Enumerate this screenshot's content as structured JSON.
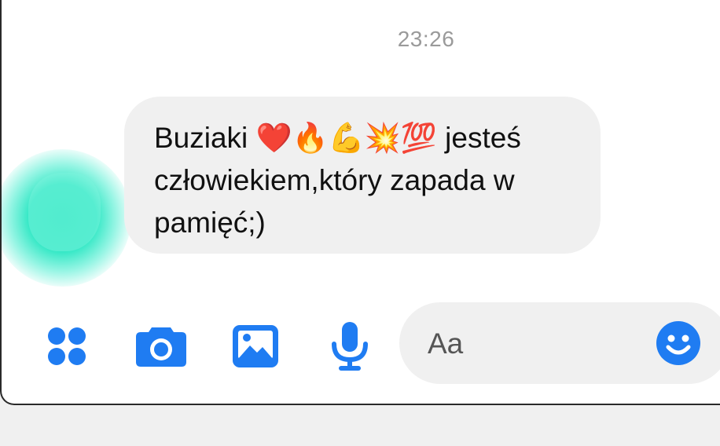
{
  "chat": {
    "timestamp": "23:26",
    "message": {
      "text": "Buziaki ❤️🔥💪💥💯 jesteś\nczłowiekiem,który zapada w\npamięć;)"
    }
  },
  "composer": {
    "placeholder": "Aa",
    "accent_color": "#1f7cf2",
    "icons": [
      "menu-icon",
      "camera-icon",
      "image-icon",
      "microphone-icon",
      "emoji-icon"
    ]
  }
}
